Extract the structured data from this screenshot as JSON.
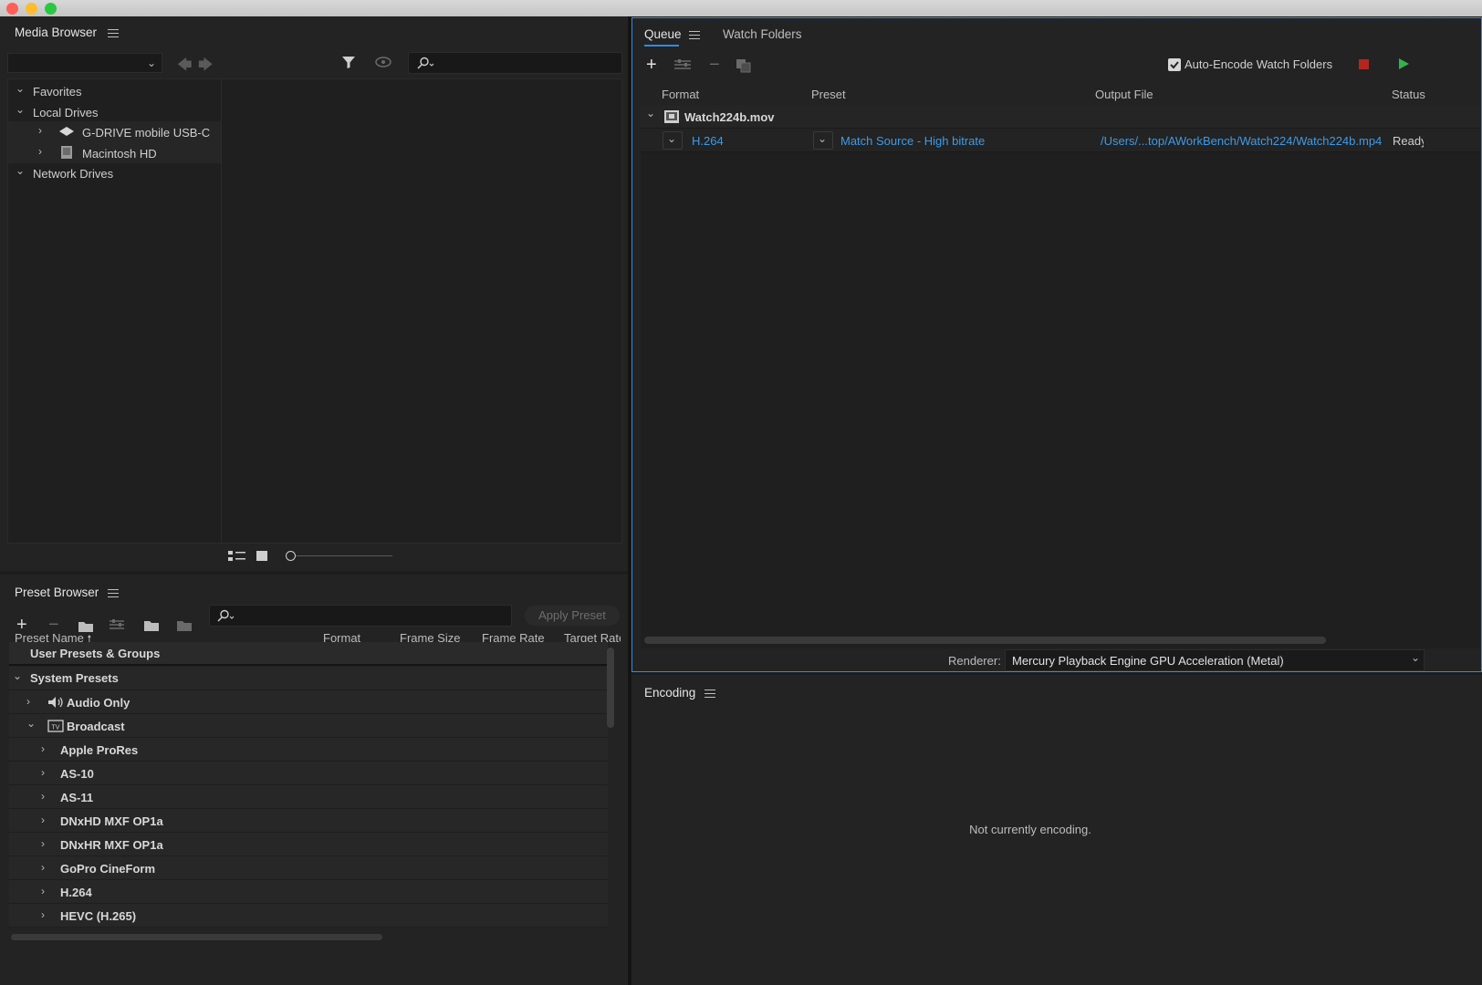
{
  "window": {
    "traffic_lights": {
      "close": "#fe5f57",
      "minimize": "#febc2e",
      "maximize": "#28c840"
    }
  },
  "colors": {
    "accent": "#2d8ceb",
    "link": "#3d9be9",
    "play": "#2fb54a",
    "stop": "#b3261e"
  },
  "media_browser": {
    "title": "Media Browser",
    "tree": {
      "favorites": "Favorites",
      "local_drives": "Local Drives",
      "drives": [
        "G-DRIVE mobile USB-C",
        "Macintosh HD"
      ],
      "network_drives": "Network Drives"
    }
  },
  "preset_browser": {
    "title": "Preset Browser",
    "apply_button": "Apply Preset",
    "columns": [
      "Preset Name",
      "Format",
      "Frame Size",
      "Frame Rate",
      "Target Rate"
    ],
    "user_presets": "User Presets & Groups",
    "system_presets": "System Presets",
    "audio_only": "Audio Only",
    "broadcast": "Broadcast",
    "broadcast_children": [
      "Apple ProRes",
      "AS-10",
      "AS-11",
      "DNxHD MXF OP1a",
      "DNxHR MXF OP1a",
      "GoPro CineForm",
      "H.264",
      "HEVC (H.265)"
    ]
  },
  "queue": {
    "tabs": [
      "Queue",
      "Watch Folders"
    ],
    "auto_encode_label": "Auto-Encode Watch Folders",
    "auto_encode_checked": true,
    "columns": [
      "Format",
      "Preset",
      "Output File",
      "Status"
    ],
    "source_file": "Watch224b.mov",
    "item": {
      "format": "H.264",
      "preset": "Match Source - High bitrate",
      "output": "/Users/...top/AWorkBench/Watch224/Watch224b.mp4",
      "status": "Ready"
    },
    "renderer_label": "Renderer:",
    "renderer_value": "Mercury Playback Engine GPU Acceleration (Metal)"
  },
  "encoding": {
    "title": "Encoding",
    "message": "Not currently encoding."
  }
}
